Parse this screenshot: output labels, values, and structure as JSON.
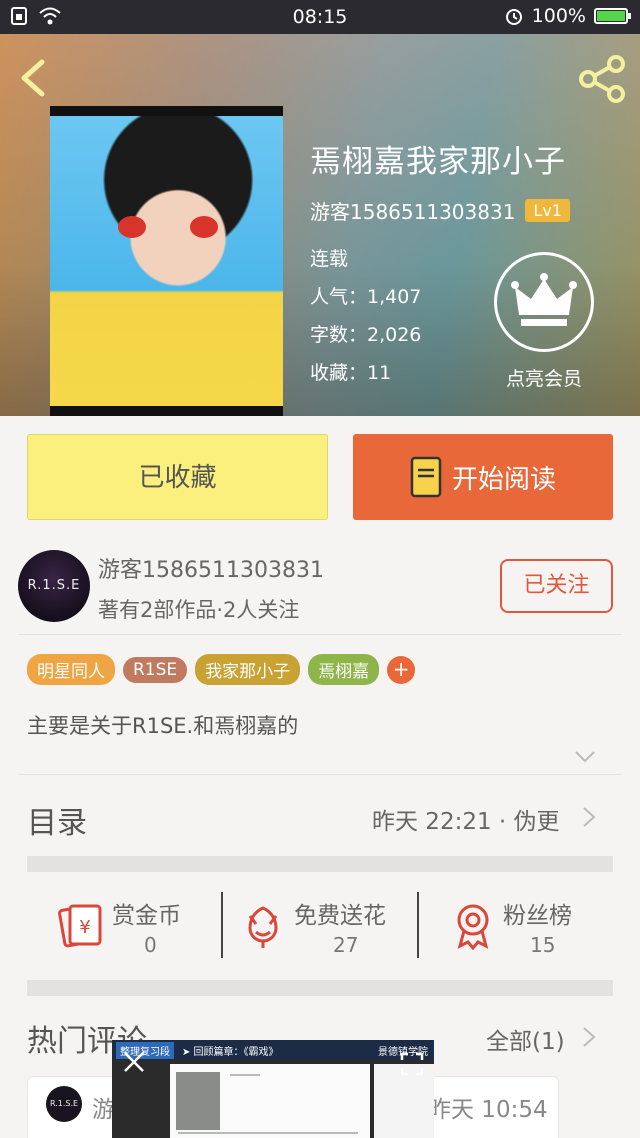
{
  "status_bar": {
    "time": "08:15",
    "battery": "100%",
    "battery_level": 1.0
  },
  "book": {
    "title": "焉栩嘉我家那小子",
    "author": "游客1586511303831",
    "level": "Lv1",
    "status": "连载",
    "popularity": "人气：1,407",
    "word_count": "字数：2,026",
    "favorites": "收藏：11"
  },
  "vip": {
    "label": "点亮会员"
  },
  "actions": {
    "favorited_label": "已收藏",
    "read_label": "开始阅读"
  },
  "author_card": {
    "avatar_text": "R.1.S.E",
    "name": "游客1586511303831",
    "desc": "著有2部作品·2人关注",
    "follow_label": "已关注"
  },
  "tags": [
    {
      "label": "明星同人",
      "color": "#f0a545"
    },
    {
      "label": "R1SE",
      "color": "#c07a5f"
    },
    {
      "label": "我家那小子",
      "color": "#c8a232"
    },
    {
      "label": "焉栩嘉",
      "color": "#8db54a"
    }
  ],
  "tag_add": "+",
  "summary": "主要是关于R1SE.和焉栩嘉的",
  "toc": {
    "title": "目录",
    "update": "昨天 22:21 · 伪更"
  },
  "rewards": [
    {
      "label": "赏金币",
      "value": "0",
      "icon": "coin-envelope-icon"
    },
    {
      "label": "免费送花",
      "value": "27",
      "icon": "flower-icon"
    },
    {
      "label": "粉丝榜",
      "value": "15",
      "icon": "medal-icon"
    }
  ],
  "comments": {
    "title": "热门评论",
    "all_label": "全部(1)",
    "first": {
      "avatar_text": "R.1.S.E",
      "name": "游",
      "time": "昨天 10:54"
    }
  },
  "pip": {
    "badge": "整理复习段",
    "subtitle": "➤ 回顾篇章：《霸戏》",
    "logo": "景德镇学院"
  },
  "colors": {
    "accent_orange": "#e9683a",
    "fav_yellow": "#fbf07d",
    "follow_red": "#e0573d"
  }
}
